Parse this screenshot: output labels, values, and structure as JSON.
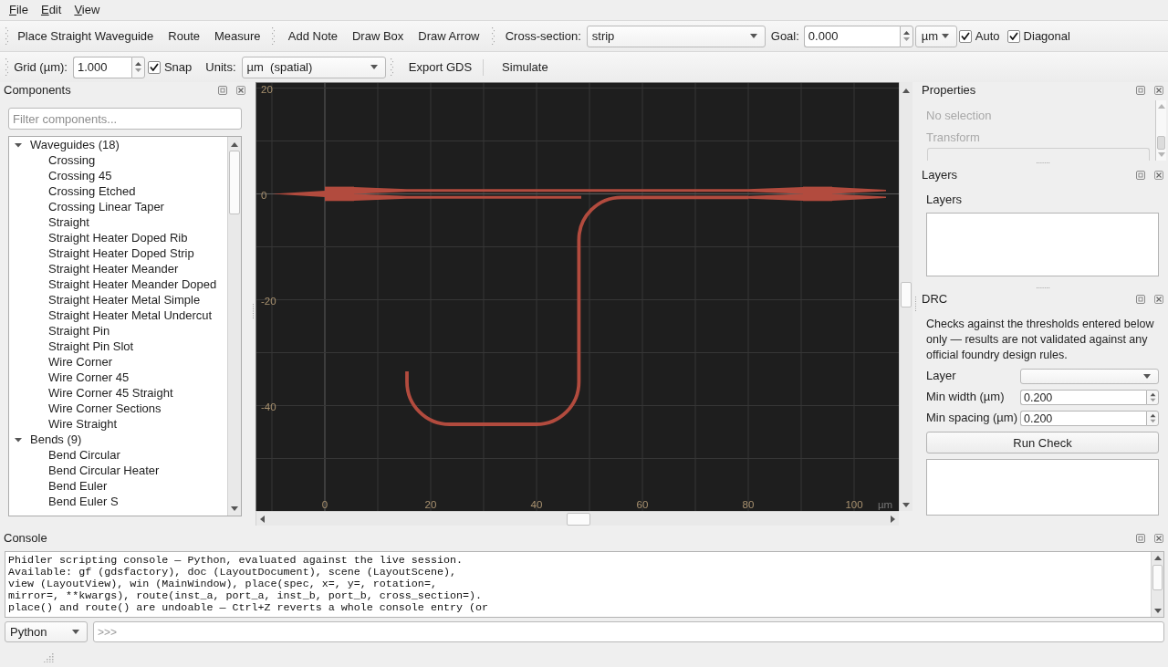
{
  "menu_bar": {
    "items": [
      "File",
      "Edit",
      "View"
    ]
  },
  "toolbar_main": {
    "tool_groups": [
      {
        "buttons": [
          "Place Straight Waveguide",
          "Route",
          "Measure"
        ]
      },
      {
        "buttons": [
          "Add Note",
          "Draw Box",
          "Draw Arrow"
        ]
      }
    ],
    "cross_section": {
      "label": "Cross-section:",
      "value": "strip"
    },
    "goal": {
      "label": "Goal:",
      "value": "0.000",
      "unit": "µm"
    },
    "toggles": [
      {
        "label": "Auto",
        "checked": true
      },
      {
        "label": "Diagonal",
        "checked": true
      }
    ]
  },
  "toolbar_grid": {
    "grid": {
      "label": "Grid (µm):",
      "value": "1.000"
    },
    "snap": {
      "label": "Snap",
      "checked": true
    },
    "units": {
      "label": "Units:",
      "value": "µm  (spatial)"
    },
    "actions": [
      "Export GDS",
      "Simulate"
    ]
  },
  "components_panel": {
    "title": "Components",
    "filter_placeholder": "Filter components...",
    "tree": [
      {
        "label": "Waveguides (18)",
        "expanded": true,
        "children": [
          {
            "label": "Crossing"
          },
          {
            "label": "Crossing 45"
          },
          {
            "label": "Crossing Etched"
          },
          {
            "label": "Crossing Linear Taper"
          },
          {
            "label": "Straight"
          },
          {
            "label": "Straight Heater Doped Rib"
          },
          {
            "label": "Straight Heater Doped Strip"
          },
          {
            "label": "Straight Heater Meander"
          },
          {
            "label": "Straight Heater Meander Doped"
          },
          {
            "label": "Straight Heater Metal Simple"
          },
          {
            "label": "Straight Heater Metal Undercut"
          },
          {
            "label": "Straight Pin"
          },
          {
            "label": "Straight Pin Slot"
          },
          {
            "label": "Wire Corner"
          },
          {
            "label": "Wire Corner 45"
          },
          {
            "label": "Wire Corner 45 Straight"
          },
          {
            "label": "Wire Corner Sections"
          },
          {
            "label": "Wire Straight"
          }
        ]
      },
      {
        "label": "Bends (9)",
        "expanded": true,
        "children": [
          {
            "label": "Bend Circular"
          },
          {
            "label": "Bend Circular Heater"
          },
          {
            "label": "Bend Euler"
          },
          {
            "label": "Bend Euler S"
          }
        ]
      }
    ]
  },
  "canvas": {
    "y_ticks": [
      "20",
      "0",
      "-20",
      "-40"
    ],
    "x_ticks": [
      "0",
      "20",
      "40",
      "60",
      "80",
      "100"
    ],
    "unit": "µm"
  },
  "properties_panel": {
    "title": "Properties",
    "disabled": true,
    "status": "No selection",
    "group_title": "Transform"
  },
  "layers_panel": {
    "title": "Layers",
    "label": "Layers"
  },
  "drc_panel": {
    "title": "DRC",
    "note": "Checks against the thresholds entered below only — results are not validated against any official foundry design rules.",
    "fields": [
      {
        "kind": "dropdown",
        "label": "Layer"
      },
      {
        "kind": "spinbox",
        "label": "Min width (µm)",
        "value": "0.200"
      },
      {
        "kind": "spinbox",
        "label": "Min spacing (µm)",
        "value": "0.200"
      }
    ],
    "button": "Run Check"
  },
  "console_panel": {
    "title": "Console",
    "lines": [
      "Phidler scripting console — Python, evaluated against the live session.",
      "Available: gf (gdsfactory), doc (LayoutDocument), scene (LayoutScene),",
      "view (LayoutView), win (MainWindow), place(spec, x=, y=, rotation=,",
      "mirror=, **kwargs), route(inst_a, port_a, inst_b, port_b, cross_section=).",
      "place() and route() are undoable — Ctrl+Z reverts a whole console entry (or"
    ],
    "language": "Python",
    "placeholder": ">>>"
  }
}
